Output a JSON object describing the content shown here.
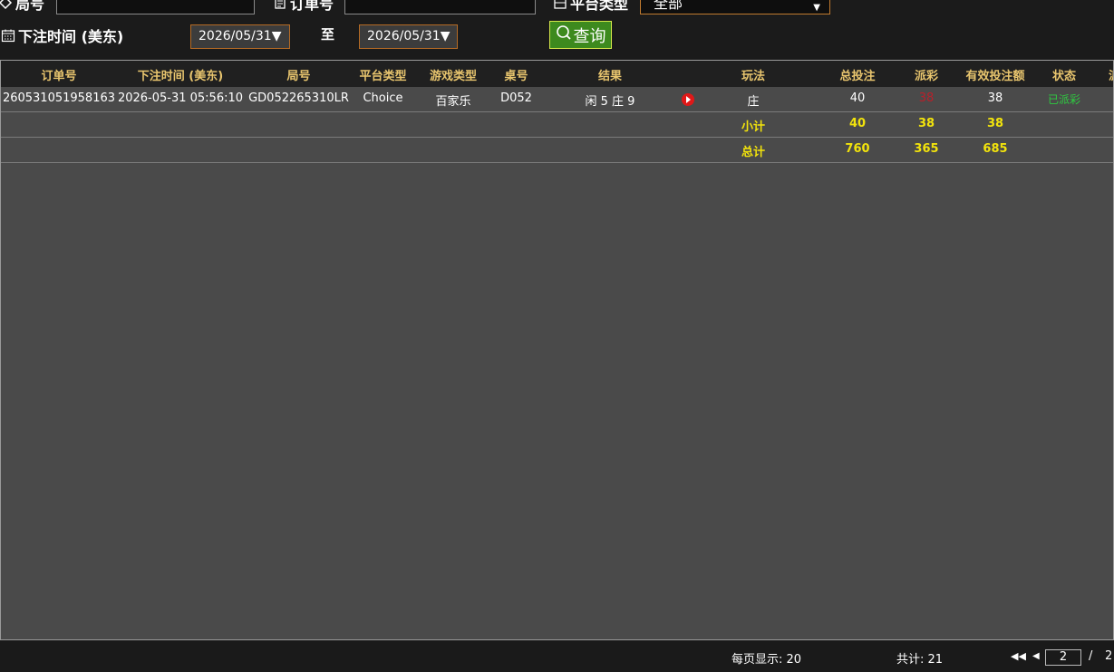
{
  "filters": {
    "round_label": "局号",
    "order_label": "订单号",
    "platform_label": "平台类型",
    "platform_value": "全部",
    "bet_time_label": "下注时间 (美东)",
    "date_from": "2026/05/31",
    "date_to": "2026/05/31",
    "to_label": "至",
    "query_label": "查询"
  },
  "table": {
    "headers": [
      "订单号",
      "下注时间 (美东)",
      "局号",
      "平台类型",
      "游戏类型",
      "桌号",
      "结果",
      "玩法",
      "总投注",
      "派彩",
      "有效投注额",
      "状态",
      "派"
    ],
    "rows": [
      {
        "order_no": "260531051958163",
        "bet_time": "2026-05-31 05:56:10",
        "round_no": "GD052265310LR",
        "platform": "Choice",
        "game_type": "百家乐",
        "table_no": "D052",
        "result": "闲 5 庄 9",
        "play": "庄",
        "total_bet": "40",
        "payout": "38",
        "valid_bet": "38",
        "status": "已派彩"
      }
    ],
    "subtotal": {
      "label": "小计",
      "total_bet": "40",
      "payout": "38",
      "valid_bet": "38"
    },
    "total": {
      "label": "总计",
      "total_bet": "760",
      "payout": "365",
      "valid_bet": "685"
    }
  },
  "footer": {
    "per_page": "每页显示: 20",
    "total_count": "共计: 21",
    "current_page": "2",
    "page_sep": "/",
    "total_pages": "2"
  },
  "colors": {
    "header_text": "#e8c56e",
    "summary_text": "#f2e30c",
    "status_paid": "#2ecc40",
    "payout_red": "#b8202a"
  }
}
